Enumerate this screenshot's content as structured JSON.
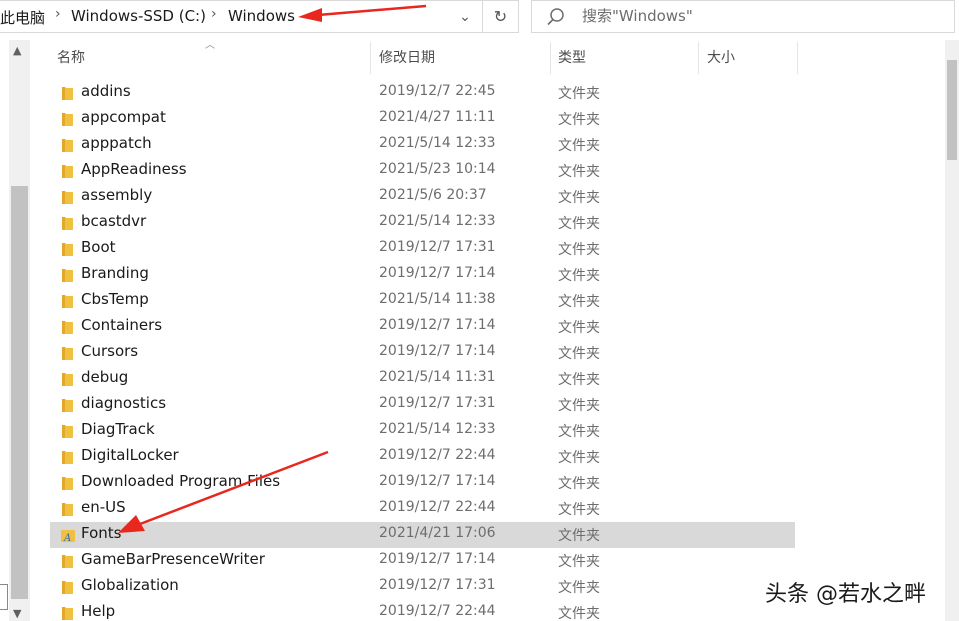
{
  "address": {
    "crumbs": [
      "此电脑",
      "Windows-SSD (C:)",
      "Windows"
    ],
    "separator": "›",
    "dropdown_glyph": "⌄",
    "refresh_glyph": "↻"
  },
  "search": {
    "placeholder": "搜索\"Windows\""
  },
  "columns": {
    "name": "名称",
    "date": "修改日期",
    "type": "类型",
    "size": "大小"
  },
  "rows": [
    {
      "name": "addins",
      "date": "2019/12/7 22:45",
      "type": "文件夹",
      "icon": "folder-icon"
    },
    {
      "name": "appcompat",
      "date": "2021/4/27 11:11",
      "type": "文件夹",
      "icon": "folder-icon"
    },
    {
      "name": "apppatch",
      "date": "2021/5/14 12:33",
      "type": "文件夹",
      "icon": "folder-icon"
    },
    {
      "name": "AppReadiness",
      "date": "2021/5/23 10:14",
      "type": "文件夹",
      "icon": "folder-icon"
    },
    {
      "name": "assembly",
      "date": "2021/5/6 20:37",
      "type": "文件夹",
      "icon": "folder-icon"
    },
    {
      "name": "bcastdvr",
      "date": "2021/5/14 12:33",
      "type": "文件夹",
      "icon": "folder-icon"
    },
    {
      "name": "Boot",
      "date": "2019/12/7 17:31",
      "type": "文件夹",
      "icon": "folder-icon"
    },
    {
      "name": "Branding",
      "date": "2019/12/7 17:14",
      "type": "文件夹",
      "icon": "folder-icon"
    },
    {
      "name": "CbsTemp",
      "date": "2021/5/14 11:38",
      "type": "文件夹",
      "icon": "folder-icon"
    },
    {
      "name": "Containers",
      "date": "2019/12/7 17:14",
      "type": "文件夹",
      "icon": "folder-icon"
    },
    {
      "name": "Cursors",
      "date": "2019/12/7 17:14",
      "type": "文件夹",
      "icon": "folder-icon"
    },
    {
      "name": "debug",
      "date": "2021/5/14 11:31",
      "type": "文件夹",
      "icon": "folder-icon"
    },
    {
      "name": "diagnostics",
      "date": "2019/12/7 17:31",
      "type": "文件夹",
      "icon": "folder-icon"
    },
    {
      "name": "DiagTrack",
      "date": "2021/5/14 12:33",
      "type": "文件夹",
      "icon": "folder-icon"
    },
    {
      "name": "DigitalLocker",
      "date": "2019/12/7 22:44",
      "type": "文件夹",
      "icon": "folder-icon"
    },
    {
      "name": "Downloaded Program Files",
      "date": "2019/12/7 17:14",
      "type": "文件夹",
      "icon": "folder-icon"
    },
    {
      "name": "en-US",
      "date": "2019/12/7 22:44",
      "type": "文件夹",
      "icon": "folder-icon"
    },
    {
      "name": "Fonts",
      "date": "2021/4/21 17:06",
      "type": "文件夹",
      "icon": "fonts-folder-icon",
      "selected": true
    },
    {
      "name": "GameBarPresenceWriter",
      "date": "2019/12/7 17:14",
      "type": "文件夹",
      "icon": "folder-icon"
    },
    {
      "name": "Globalization",
      "date": "2019/12/7 17:31",
      "type": "文件夹",
      "icon": "folder-icon"
    },
    {
      "name": "Help",
      "date": "2019/12/7 22:44",
      "type": "文件夹",
      "icon": "folder-icon"
    }
  ],
  "watermark": "头条 @若水之畔",
  "colors": {
    "folder": "#f0c040",
    "selected_row": "#d9d9d9",
    "annotation_arrow": "#e8281e"
  }
}
